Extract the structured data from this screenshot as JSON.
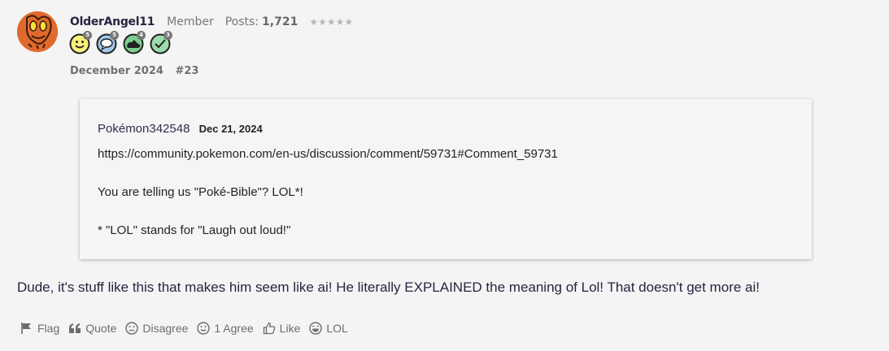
{
  "author": {
    "name": "OlderAngel11",
    "role": "Member",
    "posts_label": "Posts:",
    "posts_count": "1,721",
    "stars": "★★★★★"
  },
  "badges": [
    {
      "icon": "smiley-badge-icon",
      "count": "5"
    },
    {
      "icon": "comment-badge-icon",
      "count": "5"
    },
    {
      "icon": "shoe-badge-icon",
      "count": "4"
    },
    {
      "icon": "check-badge-icon",
      "count": "3"
    }
  ],
  "post_meta": {
    "date": "December 2024",
    "permalink": "#23"
  },
  "quote": {
    "author": "Pokémon342548",
    "date": "Dec 21, 2024",
    "link": "https://community.pokemon.com/en-us/discussion/comment/59731#Comment_59731",
    "line1": "You are telling us \"Poké-Bible\"? LOL*!",
    "line2": "* \"LOL\" stands for \"Laugh out loud!\""
  },
  "body": "Dude, it's stuff like this that makes him seem like ai! He literally EXPLAINED the meaning of Lol! That doesn't get more ai!",
  "reactions": {
    "flag": "Flag",
    "quote": "Quote",
    "disagree": "Disagree",
    "agree": "1 Agree",
    "like": "Like",
    "lol": "LOL"
  },
  "colors": {
    "background": "#f4f4f4",
    "author": "#2a2340",
    "avatar": "#e06a2e",
    "muted": "#707070"
  }
}
